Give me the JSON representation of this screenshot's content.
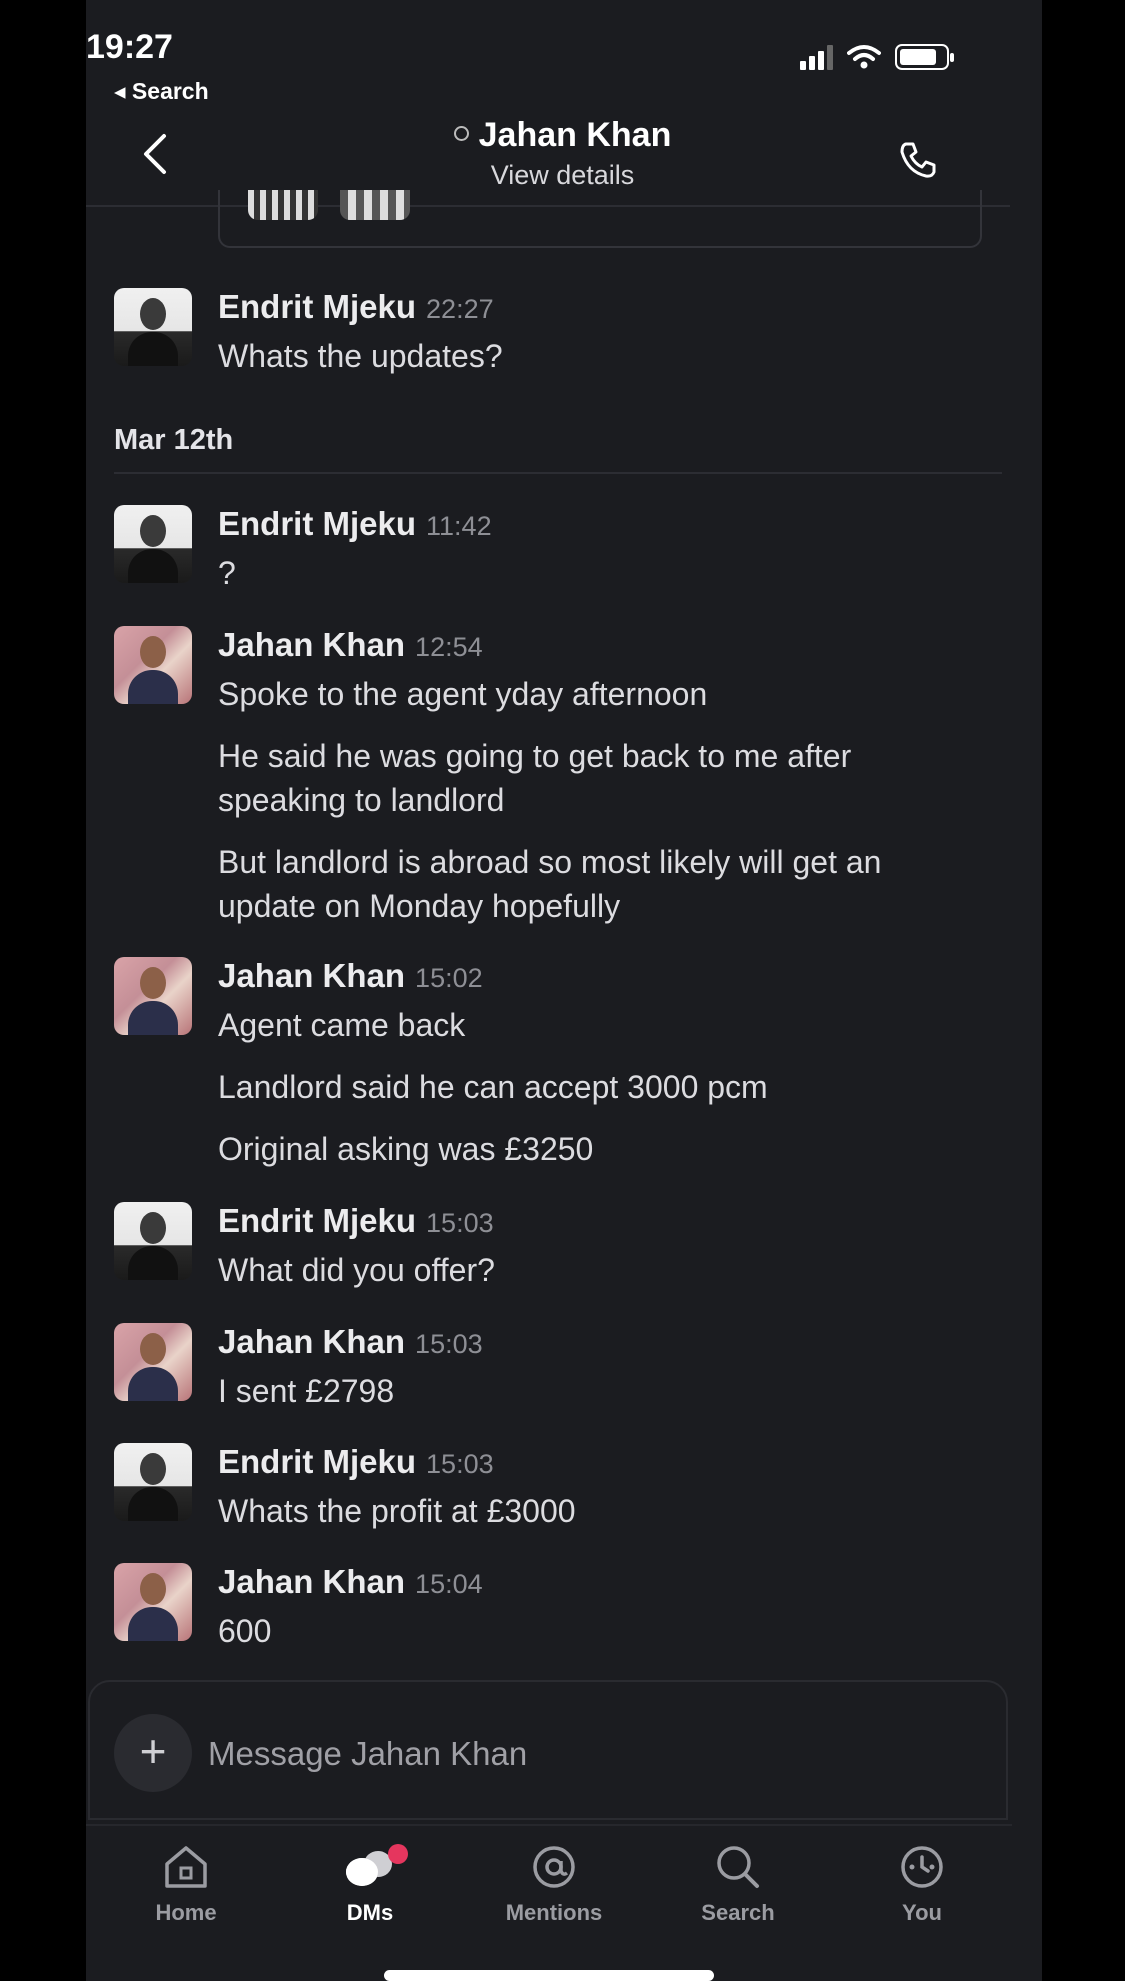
{
  "status_bar": {
    "time": "19:27",
    "back_label": "◂ Search"
  },
  "header": {
    "title": "Jahan Khan",
    "subtitle": "View details"
  },
  "date_separator": "Mar 12th",
  "messages": [
    {
      "sender": "Endrit Mjeku",
      "time": "22:27",
      "lines": [
        "Whats the updates?"
      ]
    },
    {
      "sender": "Endrit Mjeku",
      "time": "11:42",
      "lines": [
        "?"
      ]
    },
    {
      "sender": "Jahan Khan",
      "time": "12:54",
      "lines": [
        "Spoke to the agent yday afternoon",
        "He said he was going to get back to me after",
        "speaking to landlord",
        "But landlord is abroad so most likely will get an",
        "update on Monday hopefully"
      ]
    },
    {
      "sender": "Jahan Khan",
      "time": "15:02",
      "lines": [
        "Agent came back",
        "Landlord said he can accept 3000 pcm",
        "Original asking was £3250"
      ]
    },
    {
      "sender": "Endrit Mjeku",
      "time": "15:03",
      "lines": [
        "What did you offer?"
      ]
    },
    {
      "sender": "Jahan Khan",
      "time": "15:03",
      "lines": [
        "I sent £2798"
      ]
    },
    {
      "sender": "Endrit Mjeku",
      "time": "15:03",
      "lines": [
        "Whats the profit at £3000"
      ]
    },
    {
      "sender": "Jahan Khan",
      "time": "15:04",
      "lines": [
        "600"
      ]
    }
  ],
  "composer": {
    "placeholder": "Message Jahan Khan",
    "value": ""
  },
  "tabs": [
    {
      "label": "Home",
      "icon": "home-icon"
    },
    {
      "label": "DMs",
      "icon": "dms-icon",
      "active": true,
      "has_badge": true
    },
    {
      "label": "Mentions",
      "icon": "at-icon"
    },
    {
      "label": "Search",
      "icon": "search-icon"
    },
    {
      "label": "You",
      "icon": "you-icon"
    }
  ],
  "colors": {
    "background": "#1b1c20",
    "badge": "#e5365e",
    "text": "#dcdce0",
    "muted": "#8e8f95"
  }
}
